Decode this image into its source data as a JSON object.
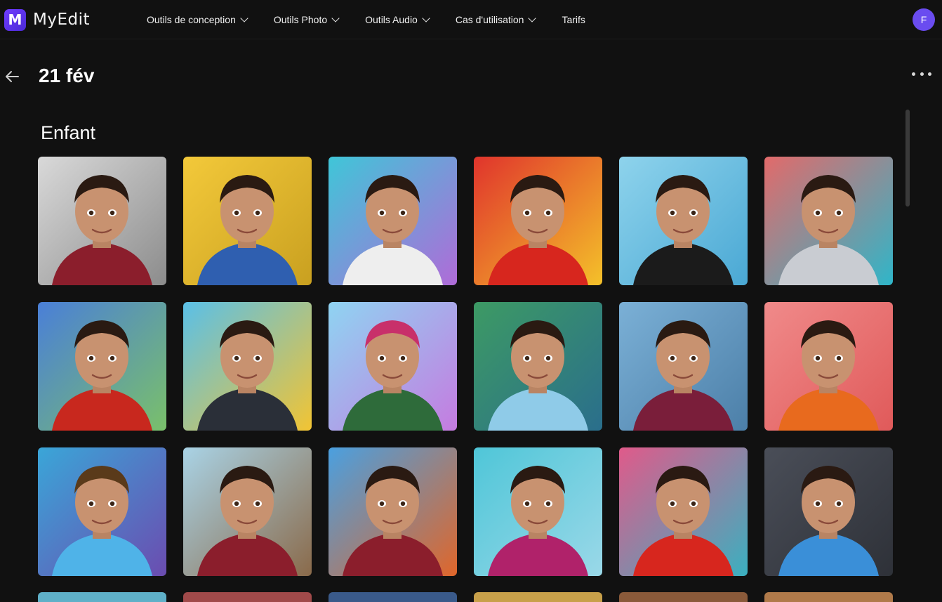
{
  "app": {
    "logo_text": "MyEdit",
    "logo_letter": "M"
  },
  "nav": [
    {
      "label": "Outils de conception",
      "dropdown": true
    },
    {
      "label": "Outils Photo",
      "dropdown": true
    },
    {
      "label": "Outils Audio",
      "dropdown": true
    },
    {
      "label": "Cas d'utilisation",
      "dropdown": true
    },
    {
      "label": "Tarifs",
      "dropdown": false
    }
  ],
  "user": {
    "avatar_initial": "F",
    "avatar_color": "#6a4cf0"
  },
  "page": {
    "title": "21 fév"
  },
  "section": {
    "title": "Enfant"
  },
  "thumbnails": [
    {
      "bg1": "#d9d9d9",
      "bg2": "#8c8c8c",
      "shirt": "#8b1e2c",
      "hair": "#2a1a12"
    },
    {
      "bg1": "#f3c93a",
      "bg2": "#c9a020",
      "shirt": "#2f5fb0",
      "hair": "#2a1a12"
    },
    {
      "bg1": "#3fc6d8",
      "bg2": "#b06bd8",
      "shirt": "#eeeeee",
      "hair": "#2a1a12"
    },
    {
      "bg1": "#e0342c",
      "bg2": "#f4c12a",
      "shirt": "#d7261e",
      "hair": "#2a1a12"
    },
    {
      "bg1": "#8ed3ec",
      "bg2": "#4aa8d4",
      "shirt": "#1b1b1b",
      "hair": "#2a1a12"
    },
    {
      "bg1": "#e26a6a",
      "bg2": "#2fb6c9",
      "shirt": "#c9ccd2",
      "hair": "#2a1a12"
    },
    {
      "bg1": "#4a7fd8",
      "bg2": "#7ac06a",
      "shirt": "#c8281e",
      "hair": "#2a1a12"
    },
    {
      "bg1": "#5ac0e8",
      "bg2": "#f2c433",
      "shirt": "#2a2f38",
      "hair": "#2a1a12"
    },
    {
      "bg1": "#8fd4f2",
      "bg2": "#c57be0",
      "shirt": "#2e6b3a",
      "hair": "#c8306a"
    },
    {
      "bg1": "#3d9a64",
      "bg2": "#2a6e8c",
      "shirt": "#8fcbe8",
      "hair": "#2a1a12"
    },
    {
      "bg1": "#7bb0d6",
      "bg2": "#4c7fa8",
      "shirt": "#7a1e3a",
      "hair": "#2a1a12"
    },
    {
      "bg1": "#f08a8a",
      "bg2": "#e05a5a",
      "shirt": "#e86a1e",
      "hair": "#2a1a12"
    },
    {
      "bg1": "#3aa6d8",
      "bg2": "#6b4cb0",
      "shirt": "#4fb3e8",
      "hair": "#5a3a1a"
    },
    {
      "bg1": "#a9d3e6",
      "bg2": "#8a6a4a",
      "shirt": "#8b1e2c",
      "hair": "#2a1a12"
    },
    {
      "bg1": "#4aa0e0",
      "bg2": "#e0662a",
      "shirt": "#8b1e2c",
      "hair": "#2a1a12"
    },
    {
      "bg1": "#4fc6d8",
      "bg2": "#9ad8e8",
      "shirt": "#b0226a",
      "hair": "#2a1a12"
    },
    {
      "bg1": "#e05a8a",
      "bg2": "#3ab0c0",
      "shirt": "#d7261e",
      "hair": "#2a1a12"
    },
    {
      "bg1": "#4a4e58",
      "bg2": "#2e3138",
      "shirt": "#3a8fd8",
      "hair": "#2a1a12"
    }
  ],
  "peek_colors": [
    "#5fb0c8",
    "#a04a4a",
    "#3a5a8a",
    "#c8a04a",
    "#8a5a3a",
    "#b07a4a"
  ]
}
